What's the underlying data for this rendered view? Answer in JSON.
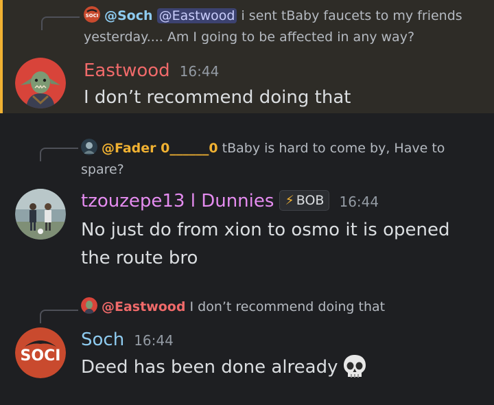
{
  "colors": {
    "background": "#1e1f22",
    "highlight_bg": "#2e2c27",
    "highlight_bar": "#f0b132",
    "eastwood": "#f06a6a",
    "soch": "#8ecbf0",
    "tzouzepe": "#e58cf0",
    "fader": "#f0b132",
    "mention_bg": "#3c4270"
  },
  "messages": [
    {
      "reply": {
        "avatar_icon": "soci-logo-icon",
        "name": "@Soch",
        "mention": "@Eastwood",
        "text": "i sent tBaby faucets to my friends yesterday.... Am I going to be affected in any way?"
      },
      "avatar_icon": "orc-warrior-avatar",
      "author": "Eastwood",
      "time": "16:44",
      "content": "I don’t recommend doing that"
    },
    {
      "reply": {
        "avatar_icon": "fader-avatar-icon",
        "name": "@Fader 0______0",
        "text": "tBaby is hard to come by, Have to spare?"
      },
      "avatar_icon": "soccer-players-avatar",
      "author": "tzouzepe13 l Dunnies",
      "role_tag": "BOB",
      "role_icon": "lightning-icon",
      "time": "16:44",
      "content": "No just do from xion to osmo it is opened the route bro"
    },
    {
      "reply": {
        "avatar_icon": "orc-warrior-avatar",
        "name": "@Eastwood",
        "text": "I don’t recommend doing that"
      },
      "avatar_icon": "soci-logo-avatar",
      "author": "Soch",
      "time": "16:44",
      "content": "Deed has been done already",
      "emoji": "skull-emoji-icon"
    }
  ]
}
